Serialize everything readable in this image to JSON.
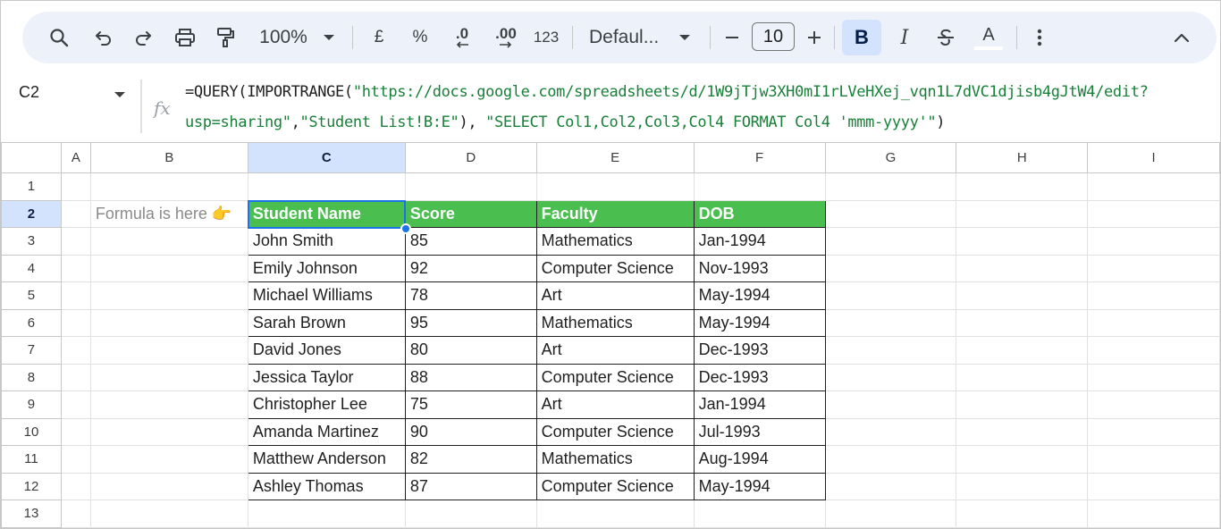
{
  "toolbar": {
    "zoom": "100%",
    "currency": "£",
    "percent": "%",
    "decrease_decimal": ".0",
    "increase_decimal": ".00",
    "number_format": "123",
    "font": "Defaul...",
    "font_size": "10",
    "bold": "B",
    "italic": "I",
    "text_color": "A",
    "icons": [
      "search-icon",
      "undo-icon",
      "redo-icon",
      "print-icon",
      "paint-format-icon",
      "chevron-down-icon",
      "minus-icon",
      "plus-icon",
      "strikethrough-icon",
      "more-vert-icon",
      "collapse-icon"
    ]
  },
  "formula_bar": {
    "cell_ref": "C2",
    "fx": "fx",
    "line1_a": "=QUERY(IMPORTRANGE(",
    "line1_b": "\"https://docs.google.com/spreadsheets/d/1W9jTjw3XH0mI1rLVeHXej_vqn1L7dVC1djisb4gJtW4/edit?",
    "line2_a": "usp=sharing\"",
    "line2_b": ",",
    "line2_c": "\"Student List!B:E\"",
    "line2_d": "), ",
    "line2_e": "\"SELECT Col1,Col2,Col3,Col4 FORMAT Col4 'mmm-yyyy'\"",
    "line2_f": ")"
  },
  "grid": {
    "columns": [
      "A",
      "B",
      "C",
      "D",
      "E",
      "F",
      "G",
      "H",
      "I"
    ],
    "rows": [
      "1",
      "2",
      "3",
      "4",
      "5",
      "6",
      "7",
      "8",
      "9",
      "10",
      "11",
      "12",
      "13"
    ],
    "selected_cell": "C2",
    "note": "Formula is here 👉",
    "headers": [
      "Student Name",
      "Score",
      "Faculty",
      "DOB"
    ],
    "data": [
      [
        "John Smith",
        "85",
        "Mathematics",
        "Jan-1994"
      ],
      [
        "Emily Johnson",
        "92",
        "Computer Science",
        "Nov-1993"
      ],
      [
        "Michael Williams",
        "78",
        "Art",
        "May-1994"
      ],
      [
        "Sarah Brown",
        "95",
        "Mathematics",
        "May-1994"
      ],
      [
        "David Jones",
        "80",
        "Art",
        "Dec-1993"
      ],
      [
        "Jessica Taylor",
        "88",
        "Computer Science",
        "Dec-1993"
      ],
      [
        "Christopher Lee",
        "75",
        "Art",
        "Jan-1994"
      ],
      [
        "Amanda Martinez",
        "90",
        "Computer Science",
        "Jul-1993"
      ],
      [
        "Matthew Anderson",
        "82",
        "Mathematics",
        "Aug-1994"
      ],
      [
        "Ashley Thomas",
        "87",
        "Computer Science",
        "May-1994"
      ]
    ],
    "colors": {
      "header_fill": "#4bbe50",
      "selection": "#1a73e8",
      "selected_header": "#d3e3fd"
    }
  }
}
